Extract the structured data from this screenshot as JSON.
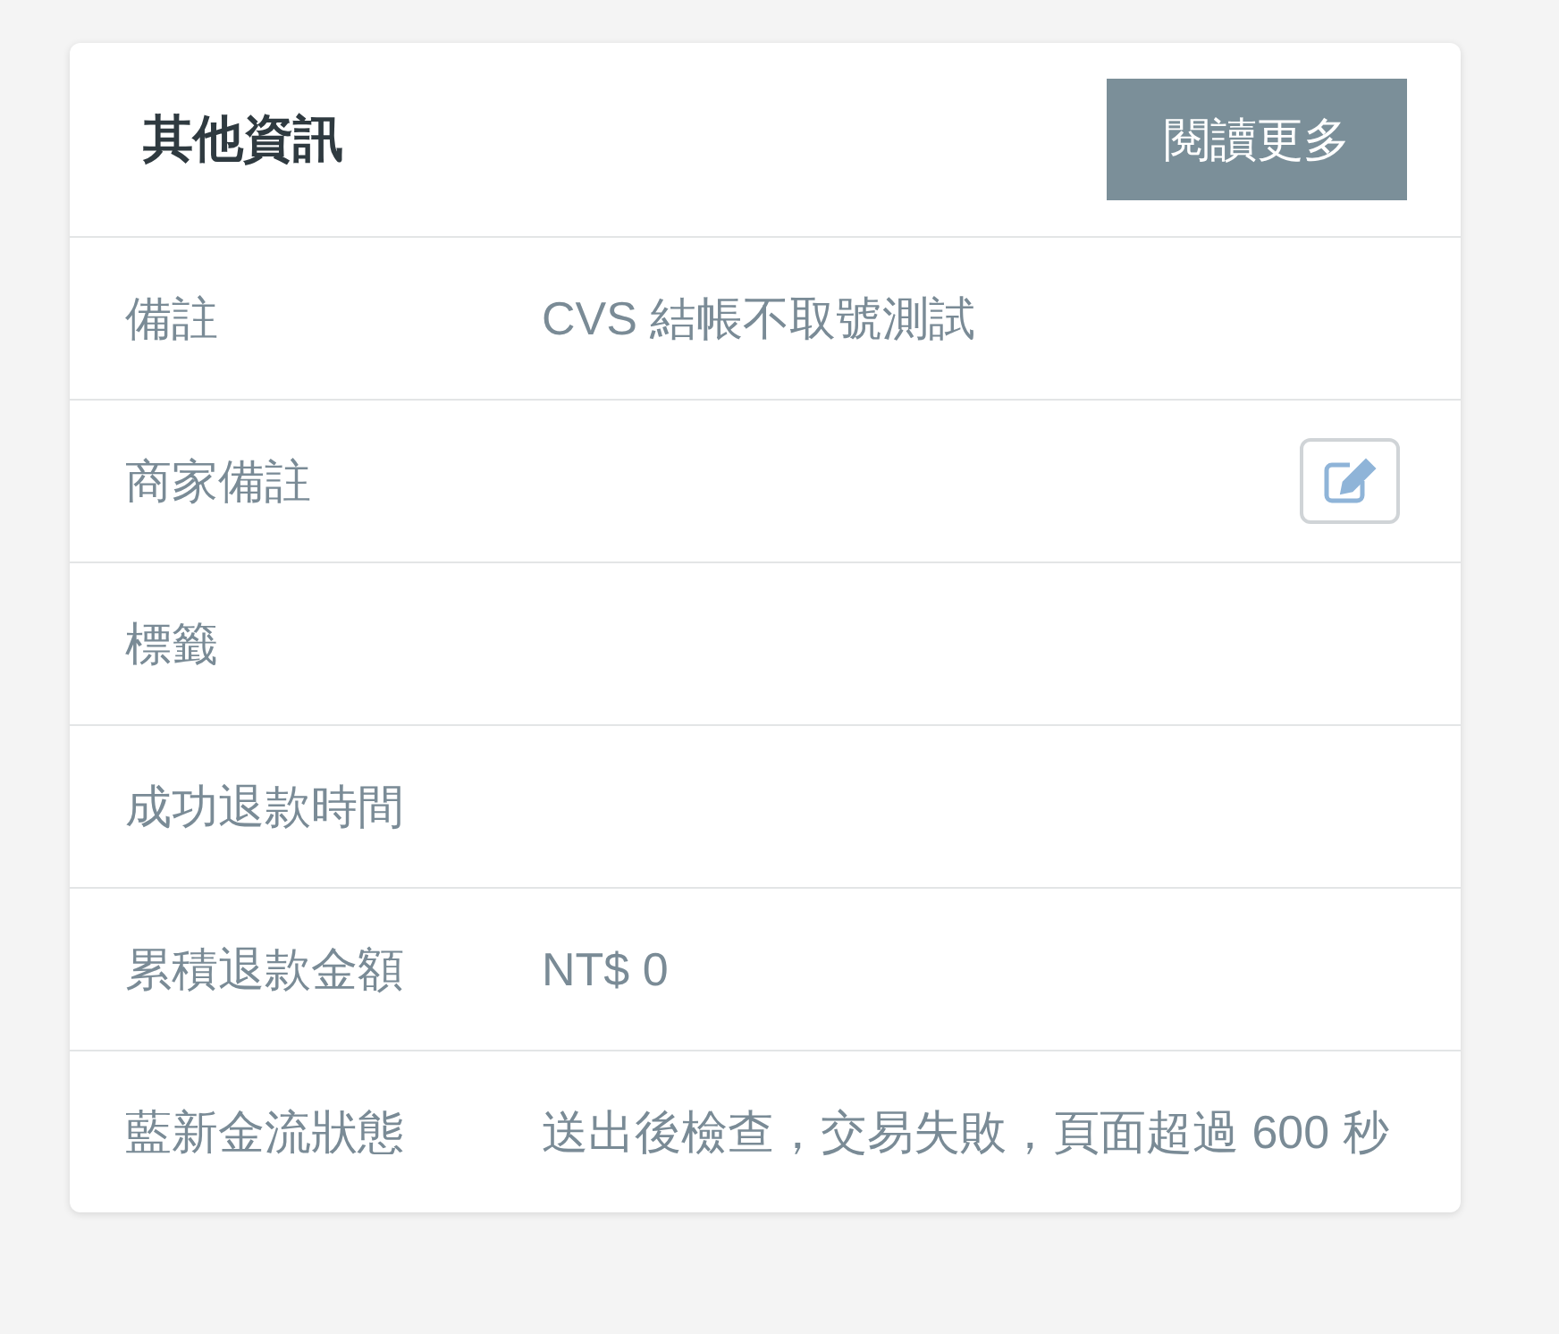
{
  "panel": {
    "title": "其他資訊",
    "button": "閱讀更多"
  },
  "rows": [
    {
      "label": "備註",
      "kind": "text",
      "value": "CVS 結帳不取號測試"
    },
    {
      "label": "商家備註",
      "kind": "edit"
    },
    {
      "label": "標籤",
      "kind": "text"
    },
    {
      "label": "成功退款時間",
      "kind": "text"
    },
    {
      "label": "累積退款金額",
      "kind": "text",
      "value": "NT$ 0"
    },
    {
      "label": "藍新金流狀態",
      "kind": "text",
      "value": "送出後檢查，交易失敗，頁面超過 600 秒"
    }
  ]
}
